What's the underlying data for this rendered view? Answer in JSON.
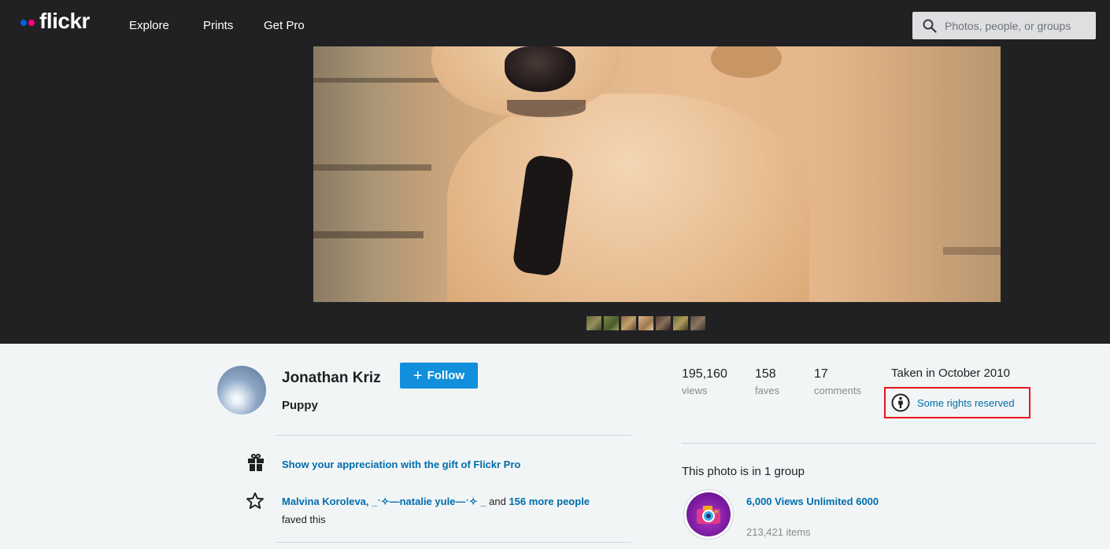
{
  "nav": {
    "brand": "flickr",
    "links": [
      "Explore",
      "Prints",
      "Get Pro"
    ],
    "search_placeholder": "Photos, people, or groups"
  },
  "photo": {
    "description": "Close-up of a light tan puppy's nose and chest wearing a dark collar",
    "filmstrip_count": 7
  },
  "owner": {
    "name": "Jonathan Kriz",
    "follow_label": "Follow",
    "photo_title": "Puppy"
  },
  "appreciation": {
    "gift_text": "Show your appreciation with the gift of Flickr Pro"
  },
  "faves": {
    "people": "Malvina Koroleva, _ˑ✧—natalie yule—ˑ✧ _",
    "and_text": "and",
    "more_link": "156 more people",
    "suffix": "faved this"
  },
  "stats": [
    {
      "value": "195,160",
      "label": "views"
    },
    {
      "value": "158",
      "label": "faves"
    },
    {
      "value": "17",
      "label": "comments"
    }
  ],
  "meta": {
    "taken": "Taken in October 2010",
    "license": "Some rights reserved"
  },
  "groups": {
    "heading": "This photo is in 1 group",
    "items": [
      {
        "name": "6,000 Views Unlimited 6000",
        "count": "213,421 items"
      }
    ]
  },
  "colors": {
    "nav_bg": "#212124",
    "accent_blue": "#0063dc",
    "accent_pink": "#ff0084",
    "link": "#006dac",
    "follow_button": "#128fdc",
    "highlight_border": "#e8161c"
  }
}
